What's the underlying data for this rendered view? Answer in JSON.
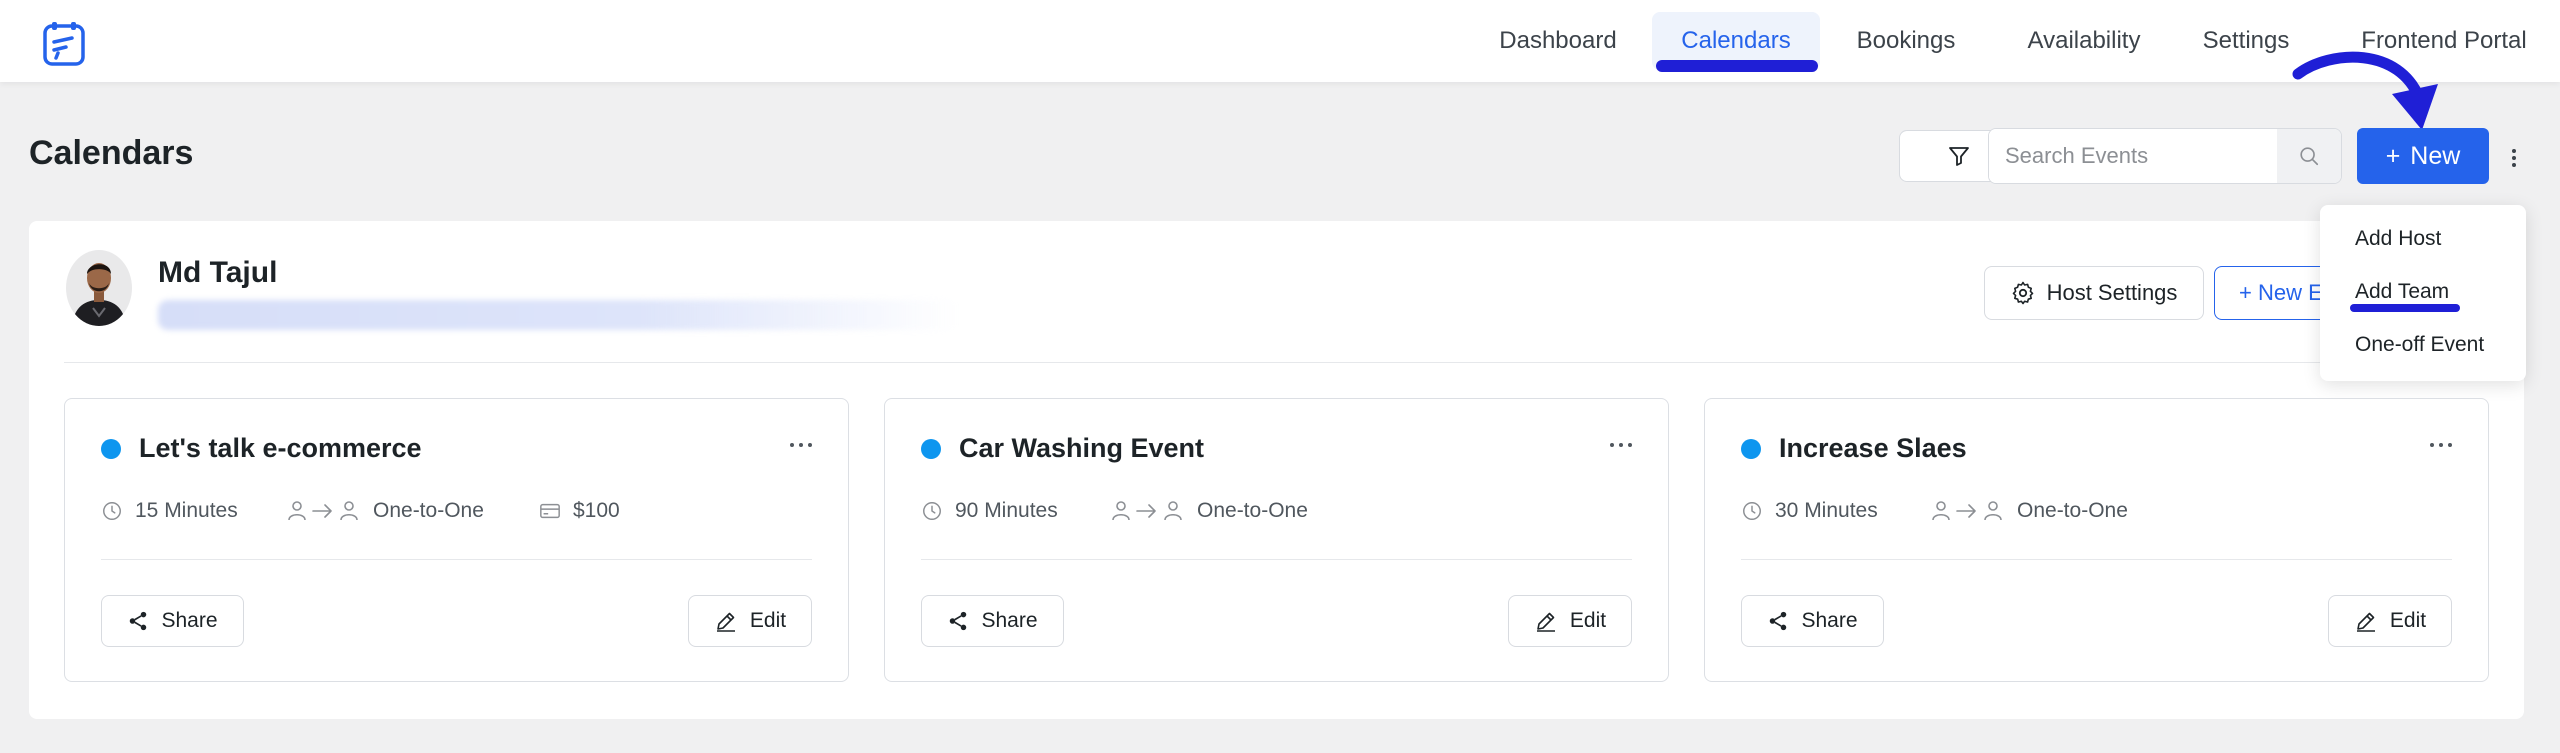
{
  "nav": {
    "items": [
      {
        "label": "Dashboard"
      },
      {
        "label": "Calendars",
        "active": true
      },
      {
        "label": "Bookings"
      },
      {
        "label": "Availability"
      },
      {
        "label": "Settings"
      },
      {
        "label": "Frontend Portal"
      }
    ]
  },
  "page": {
    "title": "Calendars"
  },
  "toolbar": {
    "search_placeholder": "Search Events",
    "new_label": "New",
    "new_icon": "+"
  },
  "host": {
    "name": "Md Tajul",
    "settings_label": "Host Settings",
    "new_event_label": "+ New E"
  },
  "dropdown": {
    "items": [
      "Add Host",
      "Add Team",
      "One-off Event"
    ]
  },
  "cards": [
    {
      "title": "Let's talk e-commerce",
      "duration": "15 Minutes",
      "type": "One-to-One",
      "price": "$100",
      "share_label": "Share",
      "edit_label": "Edit"
    },
    {
      "title": "Car Washing Event",
      "duration": "90 Minutes",
      "type": "One-to-One",
      "share_label": "Share",
      "edit_label": "Edit"
    },
    {
      "title": "Increase Slaes",
      "duration": "30 Minutes",
      "type": "One-to-One",
      "share_label": "Share",
      "edit_label": "Edit"
    }
  ],
  "colors": {
    "primary": "#2563eb",
    "annotation": "#1f1fd6",
    "event_dot": "#0e96ef"
  }
}
